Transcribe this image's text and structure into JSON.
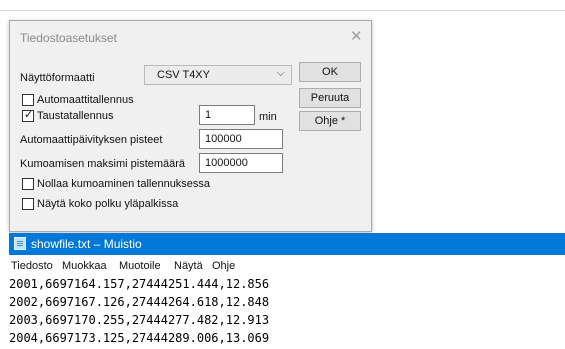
{
  "dialog": {
    "title": "Tiedostoasetukset",
    "close_glyph": "✕",
    "format_label": "Näyttöformaatti",
    "format_value": "CSV T4XY",
    "auto_save_label": "Automaattitallennus",
    "auto_save_checked": false,
    "background_save_label": "Taustatallennus",
    "background_save_checked": true,
    "background_save_value": "1",
    "background_save_unit": "min",
    "auto_update_label": "Automaattipäivityksen pisteet",
    "auto_update_value": "100000",
    "undo_max_label": "Kumoamisen maksimi pistemäärä",
    "undo_max_value": "1000000",
    "reset_undo_label": "Nollaa kumoaminen tallennuksessa",
    "reset_undo_checked": false,
    "show_path_label": "Näytä koko polku yläpalkissa",
    "show_path_checked": false,
    "buttons": {
      "ok": "OK",
      "cancel": "Peruuta",
      "help": "Ohje *"
    }
  },
  "notepad": {
    "title": "showfile.txt – Muistio",
    "menu": [
      "Tiedosto",
      "Muokkaa",
      "Muotoile",
      "Näytä",
      "Ohje"
    ],
    "lines": [
      "2001,6697164.157,27444251.444,12.856",
      "2002,6697167.126,27444264.618,12.848",
      "2003,6697170.255,27444277.482,12.913",
      "2004,6697173.125,27444289.006,13.069"
    ]
  }
}
